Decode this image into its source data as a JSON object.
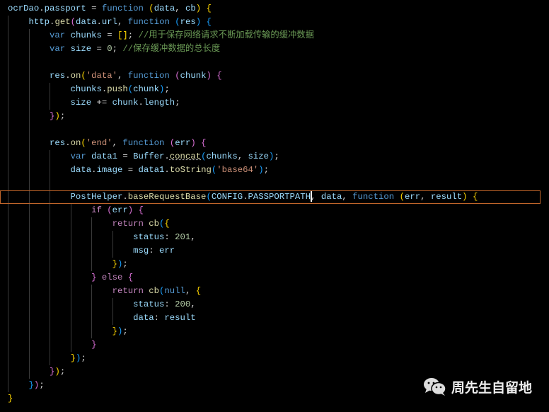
{
  "colors": {
    "keyword": "#569cd6",
    "control": "#c586c0",
    "variable": "#9cdcfe",
    "function": "#dcdcaa",
    "string": "#ce9178",
    "number": "#b5cea8",
    "comment": "#6a9955",
    "bracket1": "#ffd700",
    "bracket2": "#da70d6",
    "bracket3": "#179fff",
    "active_line_border": "#c0652a"
  },
  "code": {
    "active_line": 14,
    "cursor_after": "CONFIG.PASSPORTPATH",
    "lines": [
      [
        [
          "ocrDao",
          "var"
        ],
        [
          ".",
          "pl"
        ],
        [
          "passport",
          "prop"
        ],
        [
          " = ",
          "pl"
        ],
        [
          "function",
          "kw"
        ],
        [
          " ",
          "pl"
        ],
        [
          "(",
          "b1"
        ],
        [
          "data",
          "var"
        ],
        [
          ", ",
          "pl"
        ],
        [
          "cb",
          "var"
        ],
        [
          ")",
          "b1"
        ],
        [
          " ",
          "pl"
        ],
        [
          "{",
          "b1"
        ]
      ],
      [
        [
          "    http",
          "var"
        ],
        [
          ".",
          "pl"
        ],
        [
          "get",
          "fn"
        ],
        [
          "(",
          "b2"
        ],
        [
          "data",
          "var"
        ],
        [
          ".",
          "pl"
        ],
        [
          "url",
          "prop"
        ],
        [
          ", ",
          "pl"
        ],
        [
          "function",
          "kw"
        ],
        [
          " ",
          "pl"
        ],
        [
          "(",
          "b3"
        ],
        [
          "res",
          "var"
        ],
        [
          ")",
          "b3"
        ],
        [
          " ",
          "pl"
        ],
        [
          "{",
          "b3"
        ]
      ],
      [
        [
          "        ",
          "pl"
        ],
        [
          "var",
          "kw"
        ],
        [
          " chunks",
          "var"
        ],
        [
          " = ",
          "pl"
        ],
        [
          "[]",
          "b1"
        ],
        [
          "; ",
          "pl"
        ],
        [
          "//用于保存网络请求不断加载传输的缓冲数据",
          "cmt"
        ]
      ],
      [
        [
          "        ",
          "pl"
        ],
        [
          "var",
          "kw"
        ],
        [
          " size",
          "var"
        ],
        [
          " = ",
          "pl"
        ],
        [
          "0",
          "num"
        ],
        [
          "; ",
          "pl"
        ],
        [
          "//保存缓冲数据的总长度",
          "cmt"
        ]
      ],
      [],
      [
        [
          "        res",
          "var"
        ],
        [
          ".",
          "pl"
        ],
        [
          "on",
          "fn"
        ],
        [
          "(",
          "b1"
        ],
        [
          "'data'",
          "str"
        ],
        [
          ", ",
          "pl"
        ],
        [
          "function",
          "kw"
        ],
        [
          " ",
          "pl"
        ],
        [
          "(",
          "b2"
        ],
        [
          "chunk",
          "var"
        ],
        [
          ")",
          "b2"
        ],
        [
          " ",
          "pl"
        ],
        [
          "{",
          "b2"
        ]
      ],
      [
        [
          "            chunks",
          "var"
        ],
        [
          ".",
          "pl"
        ],
        [
          "push",
          "fn"
        ],
        [
          "(",
          "b3"
        ],
        [
          "chunk",
          "var"
        ],
        [
          ")",
          "b3"
        ],
        [
          ";",
          "pl"
        ]
      ],
      [
        [
          "            size",
          "var"
        ],
        [
          " += ",
          "pl"
        ],
        [
          "chunk",
          "var"
        ],
        [
          ".",
          "pl"
        ],
        [
          "length",
          "prop"
        ],
        [
          ";",
          "pl"
        ]
      ],
      [
        [
          "        ",
          "pl"
        ],
        [
          "}",
          "b2"
        ],
        [
          ")",
          "b1"
        ],
        [
          ";",
          "pl"
        ]
      ],
      [],
      [
        [
          "        res",
          "var"
        ],
        [
          ".",
          "pl"
        ],
        [
          "on",
          "fn"
        ],
        [
          "(",
          "b1"
        ],
        [
          "'end'",
          "str"
        ],
        [
          ", ",
          "pl"
        ],
        [
          "function",
          "kw"
        ],
        [
          " ",
          "pl"
        ],
        [
          "(",
          "b2"
        ],
        [
          "err",
          "var"
        ],
        [
          ")",
          "b2"
        ],
        [
          " ",
          "pl"
        ],
        [
          "{",
          "b2"
        ]
      ],
      [
        [
          "            ",
          "pl"
        ],
        [
          "var",
          "kw"
        ],
        [
          " data1",
          "var"
        ],
        [
          " = ",
          "pl"
        ],
        [
          "Buffer",
          "var"
        ],
        [
          ".",
          "pl"
        ],
        [
          "concat",
          "fn"
        ],
        [
          "(",
          "b3"
        ],
        [
          "chunks",
          "var"
        ],
        [
          ", ",
          "pl"
        ],
        [
          "size",
          "var"
        ],
        [
          ")",
          "b3"
        ],
        [
          ";",
          "pl"
        ]
      ],
      [
        [
          "            data",
          "var"
        ],
        [
          ".",
          "pl"
        ],
        [
          "image",
          "prop"
        ],
        [
          " = ",
          "pl"
        ],
        [
          "data1",
          "var"
        ],
        [
          ".",
          "pl"
        ],
        [
          "toString",
          "fn"
        ],
        [
          "(",
          "b3"
        ],
        [
          "'base64'",
          "str"
        ],
        [
          ")",
          "b3"
        ],
        [
          ";",
          "pl"
        ]
      ],
      [],
      [
        [
          "            PostHelper",
          "var"
        ],
        [
          ".",
          "pl"
        ],
        [
          "baseRequestBase",
          "fn"
        ],
        [
          "(",
          "b3"
        ],
        [
          "CONFIG",
          "var"
        ],
        [
          ".",
          "pl"
        ],
        [
          "PASSPORTPATH",
          "var"
        ],
        [
          ", ",
          "pl"
        ],
        [
          "data",
          "var"
        ],
        [
          ", ",
          "pl"
        ],
        [
          "function",
          "kw"
        ],
        [
          " ",
          "pl"
        ],
        [
          "(",
          "b1"
        ],
        [
          "err",
          "var"
        ],
        [
          ", ",
          "pl"
        ],
        [
          "result",
          "var"
        ],
        [
          ")",
          "b1"
        ],
        [
          " ",
          "pl"
        ],
        [
          "{",
          "b1"
        ]
      ],
      [
        [
          "                ",
          "pl"
        ],
        [
          "if",
          "ctl"
        ],
        [
          " ",
          "pl"
        ],
        [
          "(",
          "b2"
        ],
        [
          "err",
          "var"
        ],
        [
          ")",
          "b2"
        ],
        [
          " ",
          "pl"
        ],
        [
          "{",
          "b2"
        ]
      ],
      [
        [
          "                    ",
          "pl"
        ],
        [
          "return",
          "ctl"
        ],
        [
          " ",
          "pl"
        ],
        [
          "cb",
          "fn"
        ],
        [
          "(",
          "b3"
        ],
        [
          "{",
          "b1"
        ]
      ],
      [
        [
          "                        status",
          "prop"
        ],
        [
          ": ",
          "pl"
        ],
        [
          "201",
          "num"
        ],
        [
          ",",
          "pl"
        ]
      ],
      [
        [
          "                        msg",
          "prop"
        ],
        [
          ": ",
          "pl"
        ],
        [
          "err",
          "var"
        ]
      ],
      [
        [
          "                    ",
          "pl"
        ],
        [
          "}",
          "b1"
        ],
        [
          ")",
          "b3"
        ],
        [
          ";",
          "pl"
        ]
      ],
      [
        [
          "                ",
          "pl"
        ],
        [
          "}",
          "b2"
        ],
        [
          " ",
          "pl"
        ],
        [
          "else",
          "ctl"
        ],
        [
          " ",
          "pl"
        ],
        [
          "{",
          "b2"
        ]
      ],
      [
        [
          "                    ",
          "pl"
        ],
        [
          "return",
          "ctl"
        ],
        [
          " ",
          "pl"
        ],
        [
          "cb",
          "fn"
        ],
        [
          "(",
          "b3"
        ],
        [
          "null",
          "kw"
        ],
        [
          ", ",
          "pl"
        ],
        [
          "{",
          "b1"
        ]
      ],
      [
        [
          "                        status",
          "prop"
        ],
        [
          ": ",
          "pl"
        ],
        [
          "200",
          "num"
        ],
        [
          ",",
          "pl"
        ]
      ],
      [
        [
          "                        data",
          "prop"
        ],
        [
          ": ",
          "pl"
        ],
        [
          "result",
          "var"
        ]
      ],
      [
        [
          "                    ",
          "pl"
        ],
        [
          "}",
          "b1"
        ],
        [
          ")",
          "b3"
        ],
        [
          ";",
          "pl"
        ]
      ],
      [
        [
          "                ",
          "pl"
        ],
        [
          "}",
          "b2"
        ]
      ],
      [
        [
          "            ",
          "pl"
        ],
        [
          "}",
          "b1"
        ],
        [
          ")",
          "b3"
        ],
        [
          ";",
          "pl"
        ]
      ],
      [
        [
          "        ",
          "pl"
        ],
        [
          "}",
          "b2"
        ],
        [
          ")",
          "b1"
        ],
        [
          ";",
          "pl"
        ]
      ],
      [
        [
          "    ",
          "pl"
        ],
        [
          "}",
          "b3"
        ],
        [
          ")",
          "b2"
        ],
        [
          ";",
          "pl"
        ]
      ],
      [
        [
          "}",
          "b1"
        ]
      ]
    ]
  },
  "watermark": {
    "icon": "wechat-icon",
    "text": "周先生自留地"
  }
}
